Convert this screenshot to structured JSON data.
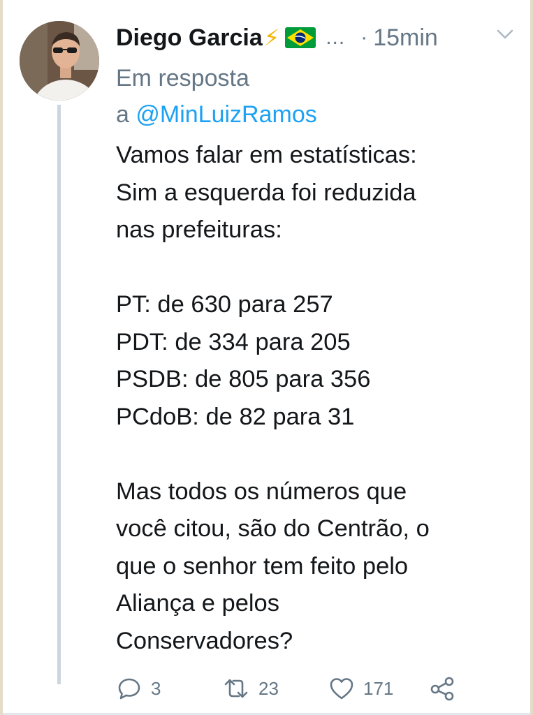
{
  "tweet": {
    "author_name": "Diego Garcia",
    "name_emoji": "⚡",
    "ellipsis": "...",
    "separator": "·",
    "time": "15min",
    "reply_prefix": "Em resposta",
    "reply_a": "a ",
    "reply_handle": "@MinLuizRamos",
    "body": "Vamos falar em estatísticas:\nSim a esquerda foi reduzida\nnas prefeituras:\n\nPT: de 630 para 257\nPDT: de 334 para 205\nPSDB: de 805 para 356\nPCdoB: de 82 para 31\n\nMas todos os números que\nvocê citou, são do Centrão, o\nque o senhor tem feito pelo\nAliança e pelos\nConservadores?"
  },
  "actions": {
    "reply_count": "3",
    "retweet_count": "23",
    "like_count": "171"
  },
  "icons": {
    "reply": "reply-icon",
    "retweet": "retweet-icon",
    "like": "heart-icon",
    "share": "share-icon",
    "menu": "chevron-down-icon",
    "flag": "brazil-flag-icon"
  },
  "colors": {
    "text": "#14171a",
    "secondary": "#657786",
    "link": "#1da1f2",
    "thread_line": "#ccd6dd",
    "flag_green": "#009c3b",
    "flag_yellow": "#ffdf00",
    "flag_blue": "#002776"
  }
}
